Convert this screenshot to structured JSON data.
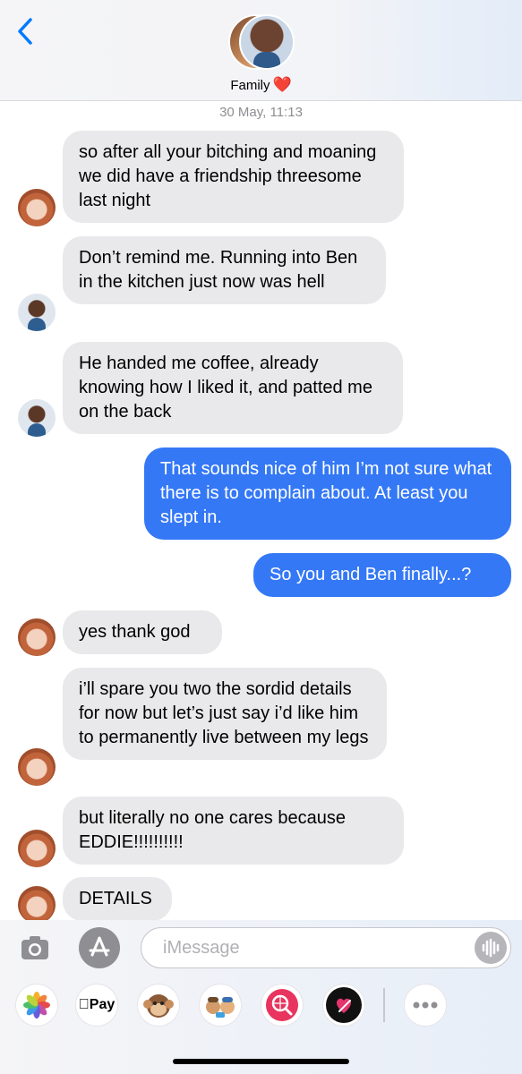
{
  "header": {
    "title": "Family",
    "heart": "❤️"
  },
  "timestamp": "30 May, 11:13",
  "messages": [
    {
      "text": "so after all your bitching and moaning we did have a friendship threesome last night"
    },
    {
      "text": "Don’t remind me. Running into Ben in the kitchen just now was hell"
    },
    {
      "text": "He handed me coffee, already knowing how I liked it, and patted me on the back"
    },
    {
      "text": "That sounds nice of him I’m not sure what there is to complain about. At least you slept in."
    },
    {
      "text": "So you and Ben finally...?"
    },
    {
      "text": "yes thank god"
    },
    {
      "text": "i’ll spare you two the sordid details for now but let’s just say i’d like him to permanently live between my legs"
    },
    {
      "text": "but literally no one cares because EDDIE!!!!!!!!!!"
    },
    {
      "text": "DETAILS"
    }
  ],
  "input": {
    "placeholder": "iMessage"
  },
  "apps": {
    "applepay": "Pay"
  },
  "colors": {
    "outgoing": "#3478f6",
    "incoming": "#e9e9eb",
    "accent": "#007aff"
  }
}
